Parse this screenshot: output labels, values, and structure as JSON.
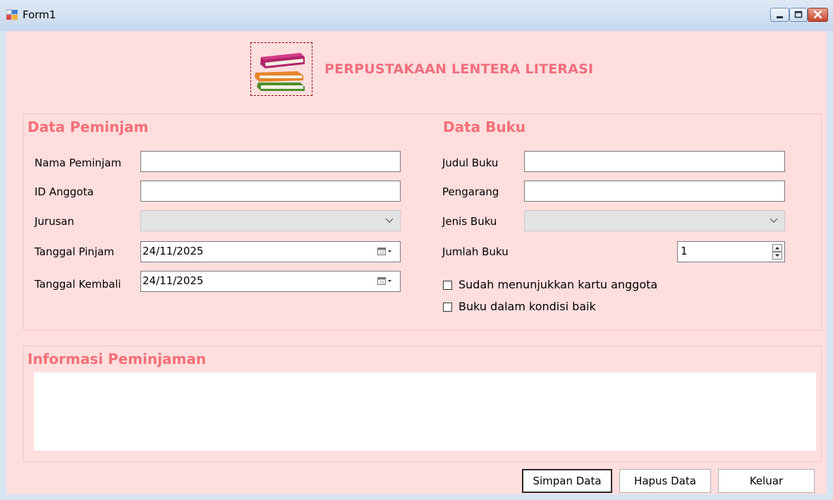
{
  "window": {
    "title": "Form1",
    "controls": [
      "minimize-icon",
      "maximize-icon",
      "close-icon"
    ]
  },
  "header": {
    "title": "PERPUSTAKAAN LENTERA LITERASI",
    "logo_icon": "books-icon"
  },
  "peminjam": {
    "title": "Data Peminjam",
    "nama_label": "Nama Peminjam",
    "nama_value": "",
    "id_label": "ID Anggota",
    "id_value": "",
    "jurusan_label": "Jurusan",
    "jurusan_value": "",
    "pinjam_label": "Tanggal Pinjam",
    "pinjam_value": "24/11/2025",
    "kembali_label": "Tanggal Kembali",
    "kembali_value": "24/11/2025"
  },
  "buku": {
    "title": "Data Buku",
    "judul_label": "Judul Buku",
    "judul_value": "",
    "pengarang_label": "Pengarang",
    "pengarang_value": "",
    "jenis_label": "Jenis Buku",
    "jenis_value": "",
    "jumlah_label": "Jumlah Buku",
    "jumlah_value": "1",
    "kartu_label": "Sudah menunjukkan kartu anggota",
    "kartu_checked": false,
    "kondisi_label": "Buku dalam kondisi baik",
    "kondisi_checked": false
  },
  "info": {
    "title": "Informasi Peminjaman",
    "text": ""
  },
  "buttons": {
    "simpan": "Simpan Data",
    "hapus": "Hapus Data",
    "keluar": "Keluar"
  },
  "colors": {
    "form_bg": "#ffdede",
    "accent": "#f37077",
    "title_bar": "#d3e2f3"
  }
}
